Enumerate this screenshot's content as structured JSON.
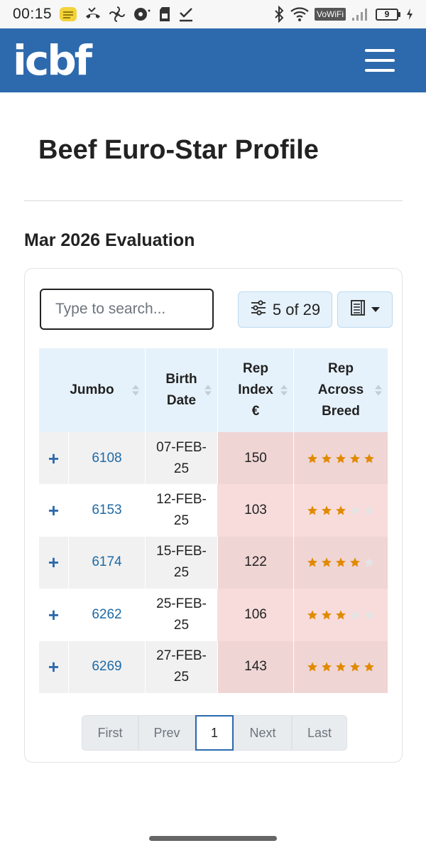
{
  "status_bar": {
    "time": "00:15",
    "vowifi": "VoWiFi",
    "battery": "9"
  },
  "header": {
    "logo": "icbf"
  },
  "page": {
    "title": "Beef Euro-Star Profile",
    "evaluation": "Mar 2026 Evaluation"
  },
  "search": {
    "placeholder": "Type to search..."
  },
  "filter": {
    "label": "5 of 29"
  },
  "table": {
    "headers": {
      "jumbo": "Jumbo",
      "birth_date_1": "Birth",
      "birth_date_2": "Date",
      "rep_index_1": "Rep",
      "rep_index_2": "Index",
      "rep_index_3": "€",
      "rep_across_1": "Rep",
      "rep_across_2": "Across",
      "rep_across_3": "Breed"
    },
    "expand_symbol": "+",
    "rows": [
      {
        "jumbo": "6108",
        "date_1": "07-FEB-",
        "date_2": "25",
        "rep_index": "150",
        "stars": 5
      },
      {
        "jumbo": "6153",
        "date_1": "12-FEB-",
        "date_2": "25",
        "rep_index": "103",
        "stars": 3
      },
      {
        "jumbo": "6174",
        "date_1": "15-FEB-",
        "date_2": "25",
        "rep_index": "122",
        "stars": 4
      },
      {
        "jumbo": "6262",
        "date_1": "25-FEB-",
        "date_2": "25",
        "rep_index": "106",
        "stars": 3
      },
      {
        "jumbo": "6269",
        "date_1": "27-FEB-",
        "date_2": "25",
        "rep_index": "143",
        "stars": 5
      }
    ],
    "star_max": 5,
    "star_colors": {
      "filled": "#e08a00",
      "empty": "#e4e4e4"
    }
  },
  "pagination": {
    "first": "First",
    "prev": "Prev",
    "current": "1",
    "next": "Next",
    "last": "Last"
  },
  "colors": {
    "brand": "#2d6aad",
    "header_bg": "#e6f2fb",
    "rep_cell_bg": "#f8dcdc"
  }
}
